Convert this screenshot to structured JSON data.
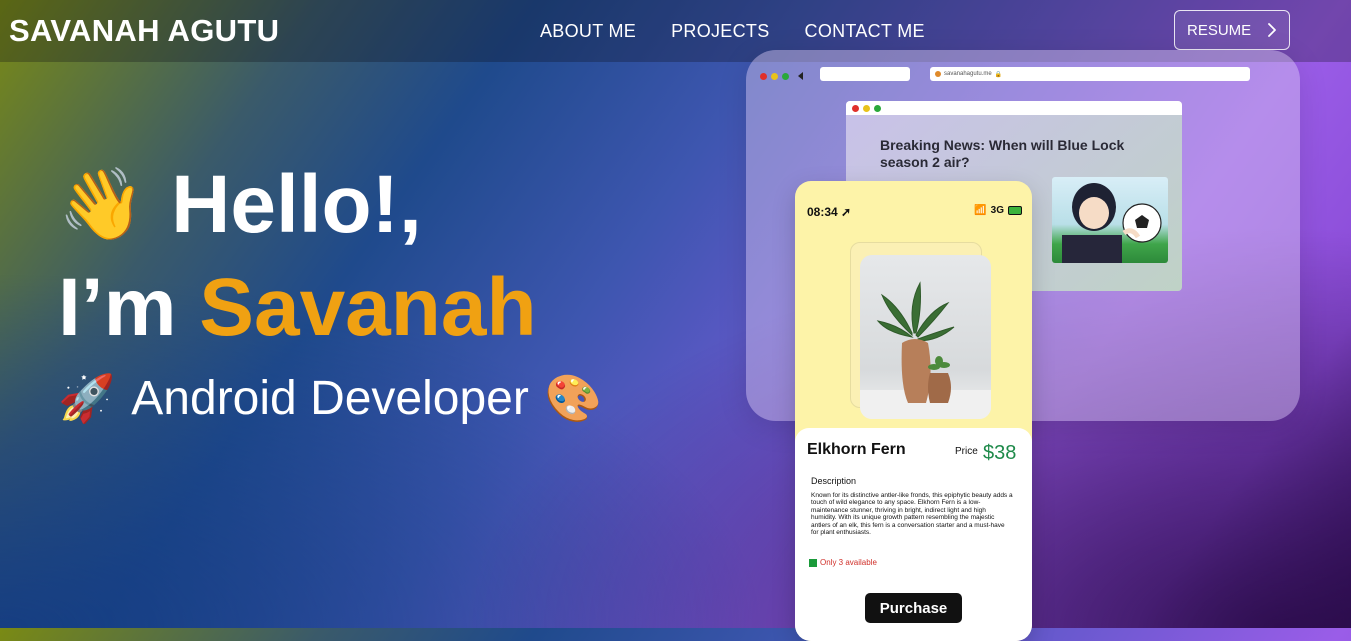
{
  "header": {
    "brand": "SAVANAH AGUTU",
    "nav": [
      "ABOUT ME",
      "PROJECTS",
      "CONTACT ME"
    ],
    "resume_label": "RESUME",
    "resume_icon": "chevron-right-icon"
  },
  "hero": {
    "greeting_emoji": "👋",
    "greeting": "Hello!,",
    "intro": "I’m",
    "name": "Savanah",
    "role_emoji_left": "🚀",
    "role": "Android Developer",
    "role_emoji_right": "🎨",
    "accent_color": "#f0a112"
  },
  "browser_mock": {
    "url": "savanahagutu.me",
    "article_title": "Breaking News:  When will Blue Lock season 2 air?"
  },
  "phone_mock": {
    "time": "08:34",
    "network": "3G",
    "product_name": "Elkhorn Fern",
    "price_label": "Price",
    "price": "$38",
    "description_label": "Description",
    "description": "Known for its distinctive antler-like fronds, this epiphytic beauty adds a touch of wild elegance to any space. Elkhorn Fern is a low-maintenance stunner, thriving in bright, indirect light and high humidity. With its unique growth pattern resembling the majestic antlers of an elk, this fern is a conversation starter and a must-have for plant enthusiasts.",
    "stock": "Only 3 available",
    "purchase_label": "Purchase",
    "price_color": "#1e8a4a"
  }
}
